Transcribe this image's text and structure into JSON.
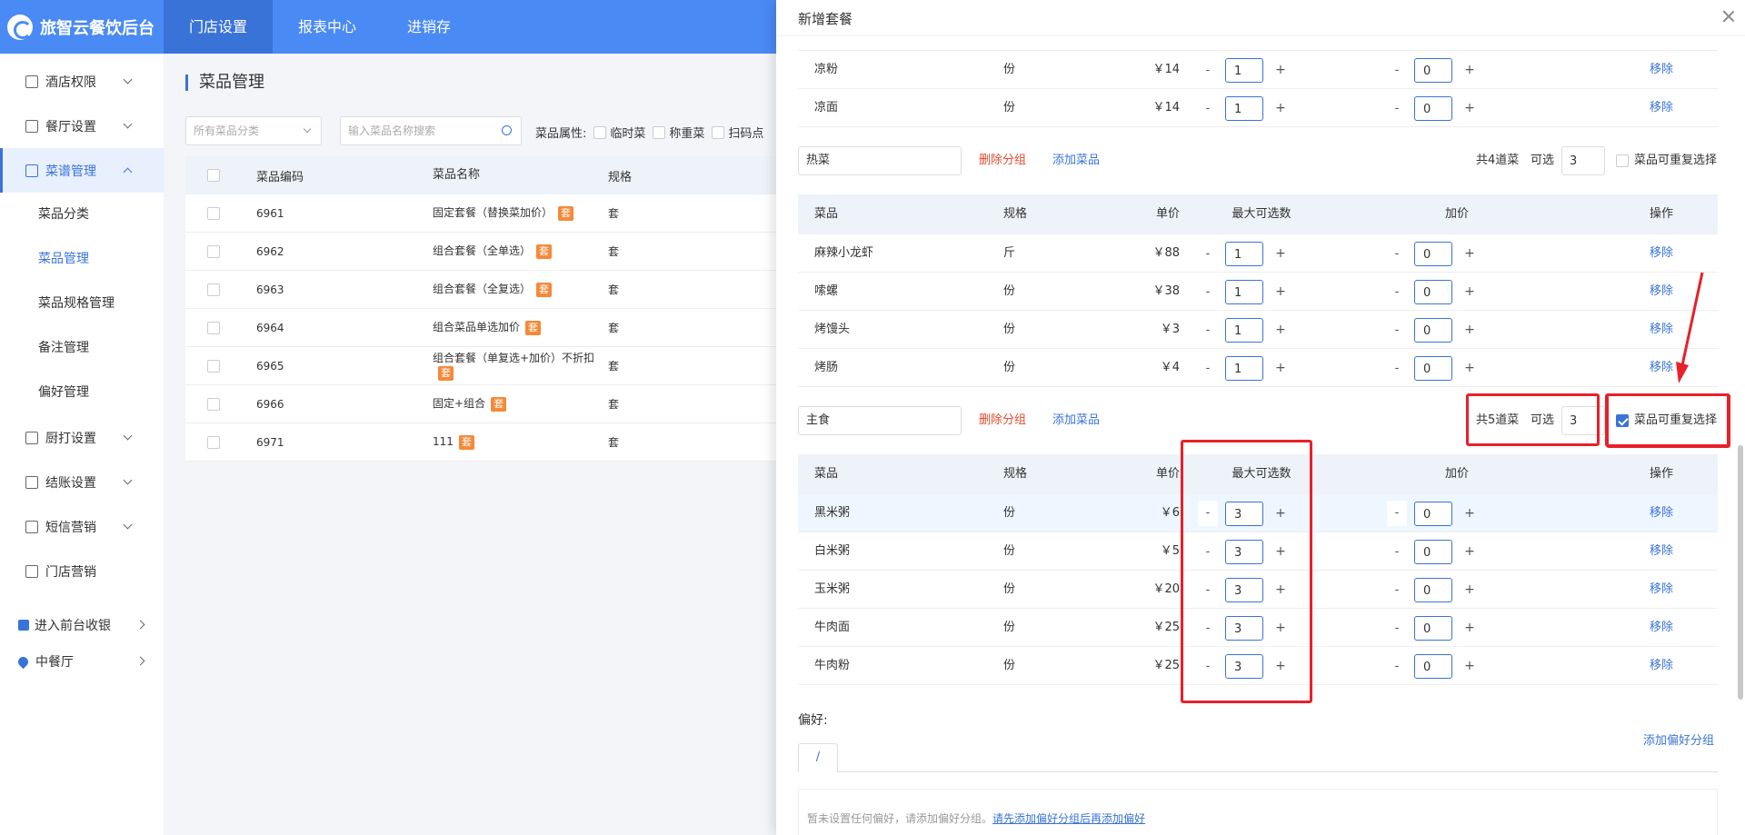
{
  "app": {
    "brand": "旅智云餐饮后台"
  },
  "topnav": [
    {
      "label": "门店设置",
      "active": true
    },
    {
      "label": "报表中心",
      "active": false
    },
    {
      "label": "进销存",
      "active": false
    }
  ],
  "sidebar": {
    "items": [
      {
        "label": "酒店权限",
        "icon": "building-icon"
      },
      {
        "label": "餐厅设置",
        "icon": "dish-icon"
      },
      {
        "label": "菜谱管理",
        "icon": "grid-icon",
        "open": true
      }
    ],
    "sub_items": [
      {
        "label": "菜品分类",
        "active": false
      },
      {
        "label": "菜品管理",
        "active": true
      },
      {
        "label": "菜品规格管理",
        "active": false
      },
      {
        "label": "备注管理",
        "active": false
      },
      {
        "label": "偏好管理",
        "active": false
      }
    ],
    "items2": [
      {
        "label": "厨打设置",
        "icon": "printer-icon"
      },
      {
        "label": "结账设置",
        "icon": "receipt-icon"
      },
      {
        "label": "短信营销",
        "icon": "mail-icon"
      },
      {
        "label": "门店营销",
        "icon": "store-icon",
        "no_chevron": true
      }
    ],
    "bottom": [
      {
        "label": "进入前台收银",
        "icon": "cashier-icon"
      },
      {
        "label": "中餐厅",
        "icon": "location-pin-icon"
      }
    ]
  },
  "background": {
    "page_title": "菜品管理",
    "filter": {
      "category_placeholder": "所有菜品分类",
      "search_placeholder": "输入菜品名称搜索",
      "attr_label": "菜品属性:",
      "attrs": [
        "临时菜",
        "称重菜",
        "扫码点"
      ]
    },
    "table": {
      "headers": [
        "菜品编码",
        "菜品名称",
        "规格"
      ],
      "tag": "套",
      "rows": [
        {
          "code": "6961",
          "name": "固定套餐（替换菜加价）",
          "spec": "套"
        },
        {
          "code": "6962",
          "name": "组合套餐（全单选）",
          "spec": "套"
        },
        {
          "code": "6963",
          "name": "组合套餐（全复选）",
          "spec": "套"
        },
        {
          "code": "6964",
          "name": "组合菜品单选加价",
          "spec": "套"
        },
        {
          "code": "6965",
          "name": "组合套餐（单复选+加价）不折扣",
          "spec": "套"
        },
        {
          "code": "6966",
          "name": "固定+组合",
          "spec": "套"
        },
        {
          "code": "6971",
          "name": "111",
          "spec": "套"
        }
      ]
    }
  },
  "drawer": {
    "title": "新增套餐",
    "remove_label": "移除",
    "minus": "-",
    "plus": "+",
    "headers": {
      "dish": "菜品",
      "spec": "规格",
      "price": "单价",
      "max": "最大可选数",
      "add": "加价",
      "op": "操作"
    },
    "group_del_label": "删除分组",
    "group_add_label": "添加菜品",
    "select_label": "可选",
    "repeat_label": "菜品可重复选择",
    "top_rows": [
      {
        "name": "凉粉",
        "unit": "份",
        "price": "￥14",
        "max": "1",
        "add": "0"
      },
      {
        "name": "凉面",
        "unit": "份",
        "price": "￥14",
        "max": "1",
        "add": "0"
      }
    ],
    "groups": [
      {
        "name": "热菜",
        "count_text": "共4道菜",
        "select": "3",
        "repeat": false,
        "rows": [
          {
            "name": "麻辣小龙虾",
            "unit": "斤",
            "price": "￥88",
            "max": "1",
            "add": "0"
          },
          {
            "name": "嗦螺",
            "unit": "份",
            "price": "￥38",
            "max": "1",
            "add": "0"
          },
          {
            "name": "烤馒头",
            "unit": "份",
            "price": "￥3",
            "max": "1",
            "add": "0"
          },
          {
            "name": "烤肠",
            "unit": "份",
            "price": "￥4",
            "max": "1",
            "add": "0"
          }
        ]
      },
      {
        "name": "主食",
        "count_text": "共5道菜",
        "select": "3",
        "repeat": true,
        "rows": [
          {
            "name": "黑米粥",
            "unit": "份",
            "price": "￥6",
            "max": "3",
            "add": "0"
          },
          {
            "name": "白米粥",
            "unit": "份",
            "price": "￥5",
            "max": "3",
            "add": "0"
          },
          {
            "name": "玉米粥",
            "unit": "份",
            "price": "￥20",
            "max": "3",
            "add": "0"
          },
          {
            "name": "牛肉面",
            "unit": "份",
            "price": "￥25",
            "max": "3",
            "add": "0"
          },
          {
            "name": "牛肉粉",
            "unit": "份",
            "price": "￥25",
            "max": "3",
            "add": "0"
          }
        ]
      }
    ],
    "preference": {
      "label": "偏好:",
      "add_label": "添加偏好分组",
      "tab": "/",
      "empty_text": "暂未设置任何偏好，请添加偏好分组。",
      "empty_link": "请先添加偏好分组后再添加偏好"
    }
  },
  "colors": {
    "primary": "#4a8af4",
    "accent": "#3a73d8",
    "danger": "#e24c2f",
    "annotation": "#e8202a",
    "tag": "#f5893a"
  }
}
